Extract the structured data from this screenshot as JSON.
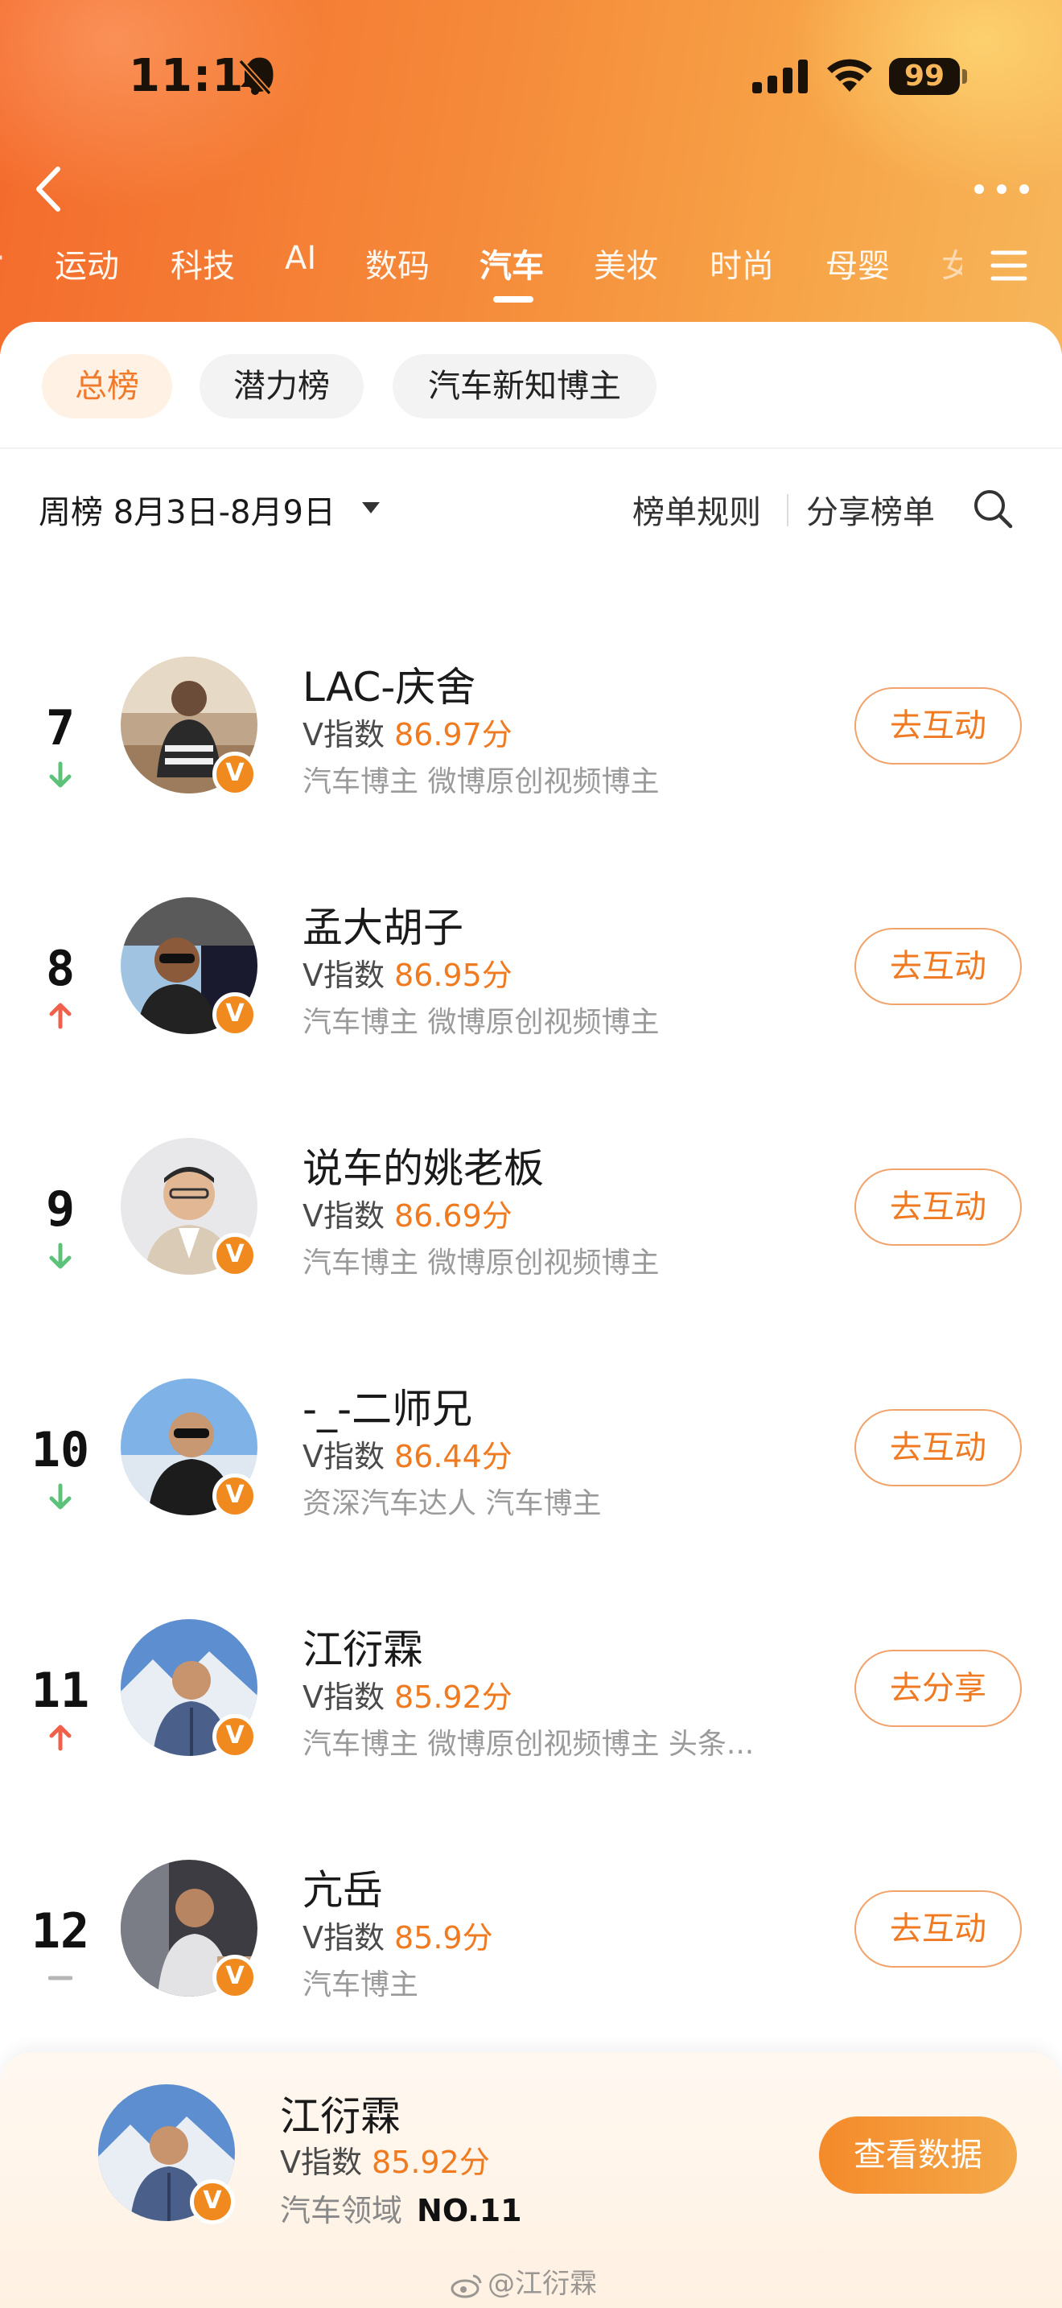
{
  "status_bar": {
    "time": "11:10",
    "battery": "99"
  },
  "categories": [
    {
      "label": "运动",
      "active": false
    },
    {
      "label": "科技",
      "active": false
    },
    {
      "label": "AI",
      "active": false
    },
    {
      "label": "数码",
      "active": false
    },
    {
      "label": "汽车",
      "active": true
    },
    {
      "label": "美妆",
      "active": false
    },
    {
      "label": "时尚",
      "active": false
    },
    {
      "label": "母婴",
      "active": false
    }
  ],
  "chips": [
    {
      "label": "总榜",
      "active": true
    },
    {
      "label": "潜力榜",
      "active": false
    },
    {
      "label": "汽车新知博主",
      "active": false
    }
  ],
  "filter": {
    "week": "周榜 8月3日-8月9日",
    "rules": "榜单规则",
    "share": "分享榜单"
  },
  "list": [
    {
      "rank": "7",
      "trend": "down",
      "name": "LAC-庆舍",
      "v_label": "V指数",
      "v_score": "86.97分",
      "tags": "汽车博主 微博原创视频博主",
      "action": "去互动"
    },
    {
      "rank": "8",
      "trend": "up",
      "name": "孟大胡子",
      "v_label": "V指数",
      "v_score": "86.95分",
      "tags": "汽车博主 微博原创视频博主",
      "action": "去互动"
    },
    {
      "rank": "9",
      "trend": "down",
      "name": "说车的姚老板",
      "v_label": "V指数",
      "v_score": "86.69分",
      "tags": "汽车博主 微博原创视频博主",
      "action": "去互动"
    },
    {
      "rank": "10",
      "trend": "down",
      "name": "-_-二师兄",
      "v_label": "V指数",
      "v_score": "86.44分",
      "tags": "资深汽车达人 汽车博主",
      "action": "去互动"
    },
    {
      "rank": "11",
      "trend": "up",
      "name": "江衍霖",
      "v_label": "V指数",
      "v_score": "85.92分",
      "tags": "汽车博主 微博原创视频博主 头条...",
      "action": "去分享"
    },
    {
      "rank": "12",
      "trend": "same",
      "name": "亢岳",
      "v_label": "V指数",
      "v_score": "85.9分",
      "tags": "汽车博主",
      "action": "去互动"
    }
  ],
  "me": {
    "name": "江衍霖",
    "v_label": "V指数",
    "v_score": "85.92分",
    "field": "汽车领域",
    "rank_no": "NO.11",
    "button": "查看数据"
  },
  "watermark": "@江衍霖",
  "badge_text": "V",
  "colors": {
    "accent": "#f07a1f",
    "trend_up": "#f0604a",
    "trend_down": "#5cc27a",
    "trend_same": "#b5b5b5"
  }
}
